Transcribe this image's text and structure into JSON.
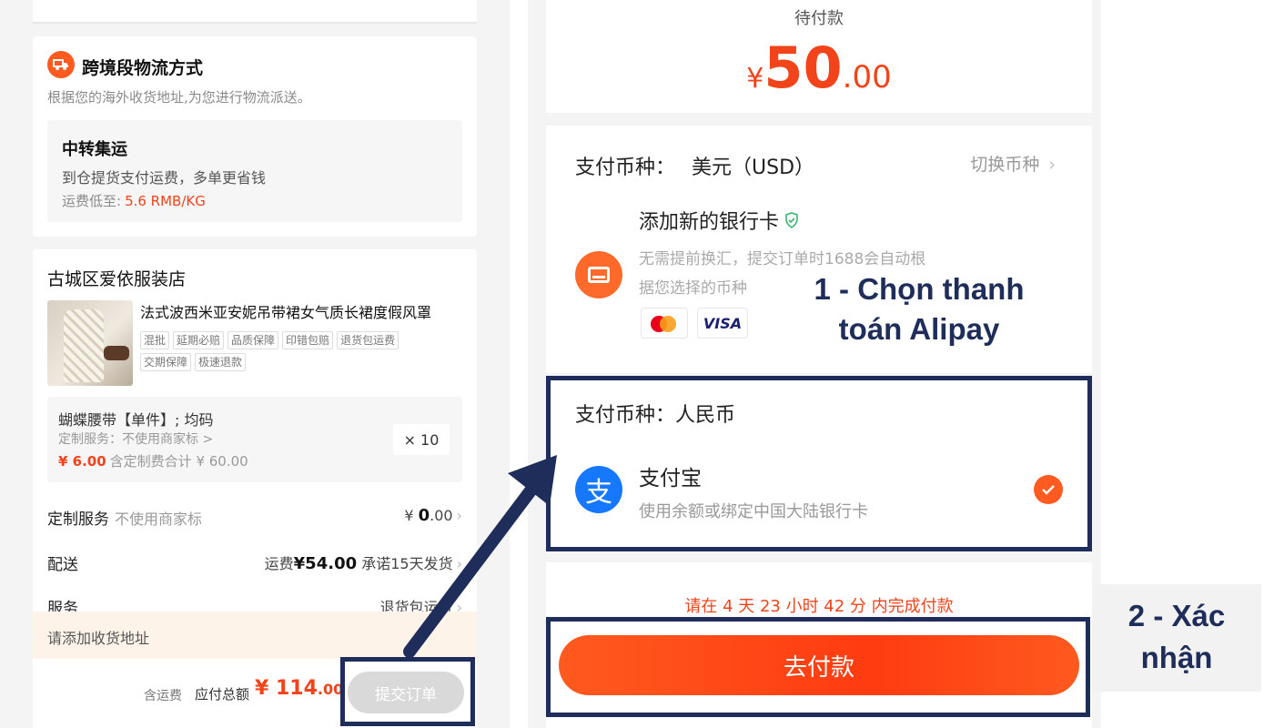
{
  "left": {
    "shipping": {
      "title": "跨境段物流方式",
      "desc": "根据您的海外收货地址,为您进行物流派送。",
      "option_title": "中转集运",
      "option_desc": "到仓提货支付运费，多单更省钱",
      "fee_label": "运费低至:",
      "fee_value": "5.6 RMB/KG"
    },
    "shop": {
      "name": "古城区爱依服装店",
      "product_title": "法式波西米亚安妮吊带裙女气质长裙度假风罩",
      "tags": [
        "混批",
        "延期必赔",
        "品质保障",
        "印错包赔",
        "退货包运费",
        "交期保障",
        "极速退款"
      ],
      "sku_name": "蝴蝶腰带【单件】; 均码",
      "sku_custom": "定制服务：不使用商家标 >",
      "sku_price": "¥ 6.00",
      "sku_total": "含定制费合计 ¥ 60.00",
      "qty": "× 10"
    },
    "rows": {
      "custom_label": "定制服务",
      "custom_sub": "不使用商家标",
      "custom_currency": "¥",
      "custom_int": "0",
      "custom_dec": ".00",
      "delivery_label": "配送",
      "delivery_fee_label": "运费",
      "delivery_fee": "¥54.00",
      "delivery_promise": "承诺15天发货",
      "service_label": "服务",
      "service_value": "退货包运费"
    },
    "address_prompt": "请添加收货地址",
    "bottom": {
      "shipping_incl": "含运费",
      "total_label": "应付总额",
      "total_currency": "¥",
      "total_int": "114",
      "total_dec": ".00",
      "submit": "提交订单"
    }
  },
  "right": {
    "pending_label": "待付款",
    "amount": {
      "currency": "¥",
      "integer": "50",
      "decimal": ".00"
    },
    "currency_card": {
      "label": "支付币种：",
      "value": "美元（USD）",
      "switch": "切换币种",
      "add_card": "添加新的银行卡",
      "desc_line1": "无需提前换汇，提交订单时1688会自动根",
      "desc_line2": "据您选择的币种",
      "visa": "VISA"
    },
    "alipay_card": {
      "currency": "支付币种：人民币",
      "name": "支付宝",
      "desc": "使用余额或绑定中国大陆银行卡",
      "icon_glyph": "支"
    },
    "countdown": "请在 4 天 23 小时 42 分 内完成付款",
    "pay_button": "去付款"
  },
  "annotations": {
    "step1_line1": "1 - Chọn thanh",
    "step1_line2": "toán Alipay",
    "step2_line1": "2 - Xác",
    "step2_line2": "nhận"
  },
  "colors": {
    "accent_orange": "#ff5a1f",
    "price_red": "#f2431b",
    "annotation_navy": "#1f2d5a",
    "alipay_blue": "#1677ff"
  }
}
